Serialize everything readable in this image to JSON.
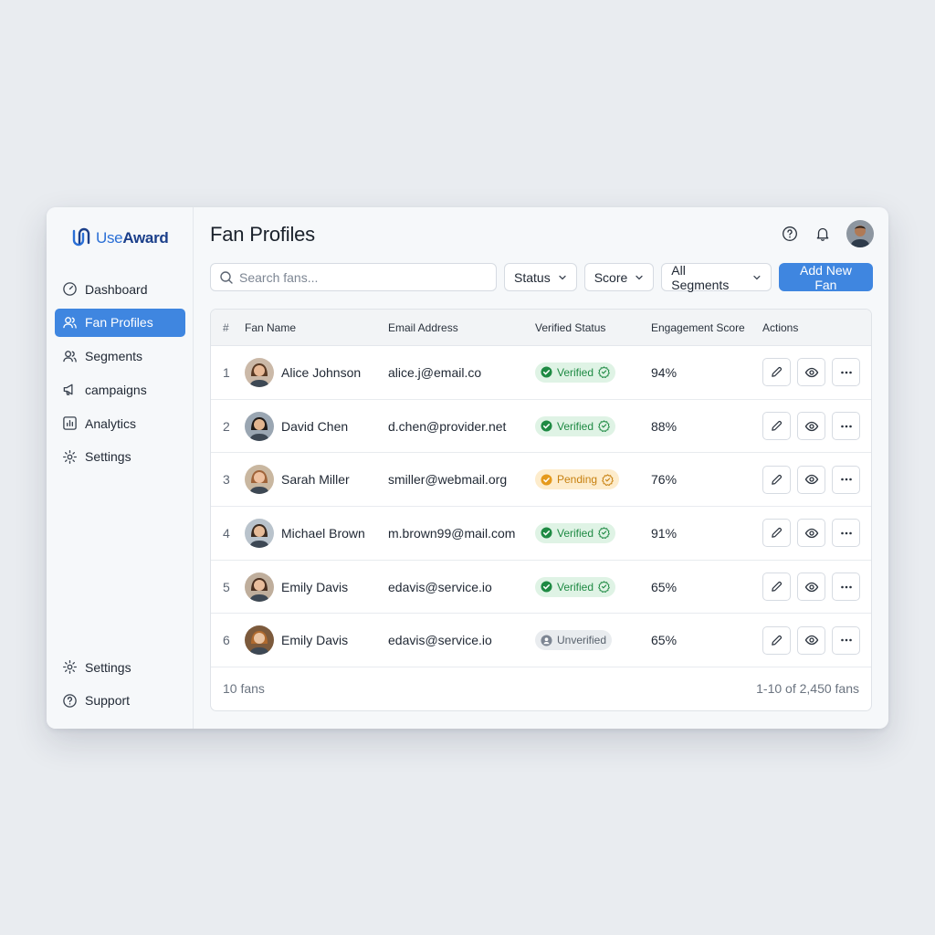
{
  "brand": {
    "use": "Use",
    "award": "Award"
  },
  "sidebar": {
    "items": [
      {
        "label": "Dashboard",
        "icon": "gauge-icon",
        "active": false
      },
      {
        "label": "Fan Profiles",
        "icon": "users-icon",
        "active": true
      },
      {
        "label": "Segments",
        "icon": "group-icon",
        "active": false
      },
      {
        "label": "campaigns",
        "icon": "megaphone-icon",
        "active": false
      },
      {
        "label": "Analytics",
        "icon": "chart-icon",
        "active": false
      },
      {
        "label": "Settings",
        "icon": "gear-icon",
        "active": false
      }
    ],
    "bottom": [
      {
        "label": "Settings",
        "icon": "gear-icon"
      },
      {
        "label": "Support",
        "icon": "help-circle-icon"
      }
    ]
  },
  "header": {
    "title": "Fan Profiles"
  },
  "toolbar": {
    "search_placeholder": "Search fans...",
    "status_label": "Status",
    "score_label": "Score",
    "segments_label": "All Segments",
    "add_label": "Add New Fan"
  },
  "table": {
    "columns": [
      "#",
      "Fan Name",
      "Email Address",
      "Verified Status",
      "Engagement Score",
      "Actions"
    ],
    "rows": [
      {
        "num": "1",
        "name": "Alice Johnson",
        "email": "alice.j@email.co",
        "status": "Verified",
        "status_type": "verified",
        "score": "94%"
      },
      {
        "num": "2",
        "name": "David Chen",
        "email": "d.chen@provider.net",
        "status": "Verified",
        "status_type": "verified",
        "score": "88%"
      },
      {
        "num": "3",
        "name": "Sarah Miller",
        "email": "smiller@webmail.org",
        "status": "Pending",
        "status_type": "pending",
        "score": "76%"
      },
      {
        "num": "4",
        "name": "Michael Brown",
        "email": "m.brown99@mail.com",
        "status": "Verified",
        "status_type": "verified",
        "score": "91%"
      },
      {
        "num": "5",
        "name": "Emily Davis",
        "email": "edavis@service.io",
        "status": "Verified",
        "status_type": "verified",
        "score": "65%"
      },
      {
        "num": "6",
        "name": "Emily Davis",
        "email": "edavis@service.io",
        "status": "Unverified",
        "status_type": "unverified",
        "score": "65%"
      }
    ],
    "footer_left": "10 fans",
    "footer_right": "1-10 of 2,450 fans"
  },
  "colors": {
    "accent": "#3f86e0",
    "verified": "#1e8a43",
    "pending": "#c7800f",
    "unverified": "#59626d"
  }
}
